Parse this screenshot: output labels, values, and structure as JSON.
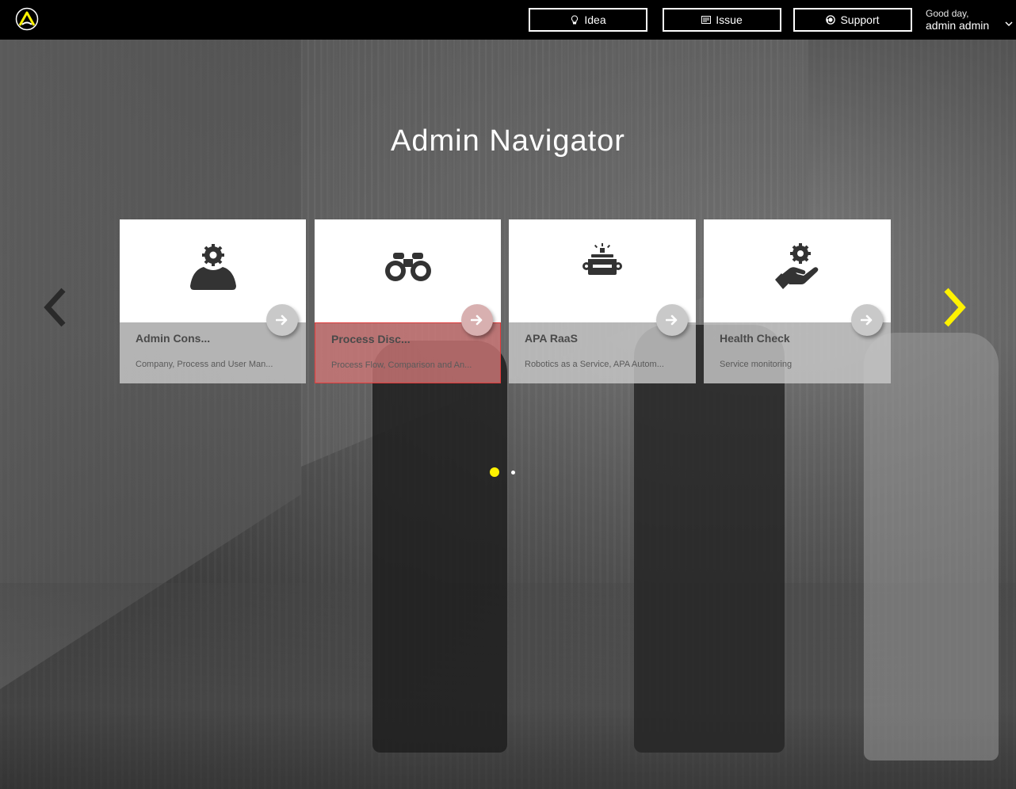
{
  "header": {
    "buttons": {
      "idea": "Idea",
      "issue": "Issue",
      "support": "Support"
    },
    "user": {
      "greeting": "Good day,",
      "name": "admin admin"
    }
  },
  "main": {
    "title": "Admin Navigator",
    "cards": [
      {
        "title": "Admin Cons...",
        "description": "Company, Process and User Man...",
        "icon": "user-gear-icon"
      },
      {
        "title": "Process Disc...",
        "description": "Process Flow, Comparison and An...",
        "icon": "binoculars-icon"
      },
      {
        "title": "APA RaaS",
        "description": "Robotics as a Service, APA Autom...",
        "icon": "robot-icon"
      },
      {
        "title": "Health Check",
        "description": "Service monitoring",
        "icon": "hand-gear-icon"
      }
    ],
    "selected_card_index": 1,
    "carousel": {
      "page_count": 2,
      "current_page": 1
    }
  },
  "colors": {
    "accent": "#fff200",
    "topbar": "#000000",
    "card_icon": "#333333",
    "selected_border": "#e03a3a"
  }
}
